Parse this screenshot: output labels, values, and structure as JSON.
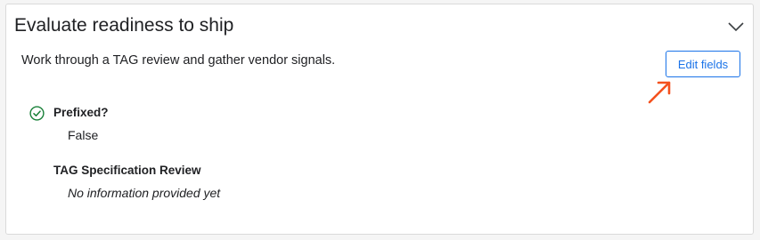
{
  "card": {
    "title": "Evaluate readiness to ship",
    "description": "Work through a TAG review and gather vendor signals.",
    "edit_button_label": "Edit fields"
  },
  "fields": [
    {
      "label": "Prefixed?",
      "value": "False",
      "status_icon": "check-circle-icon"
    },
    {
      "label": "TAG Specification Review",
      "value": "No information provided yet"
    }
  ],
  "icons": {
    "collapse": "chevron-down-icon",
    "pointer": "arrow-annotation-icon"
  },
  "colors": {
    "accent": "#1a73e8",
    "success": "#188038",
    "annotation": "#f4511e"
  }
}
